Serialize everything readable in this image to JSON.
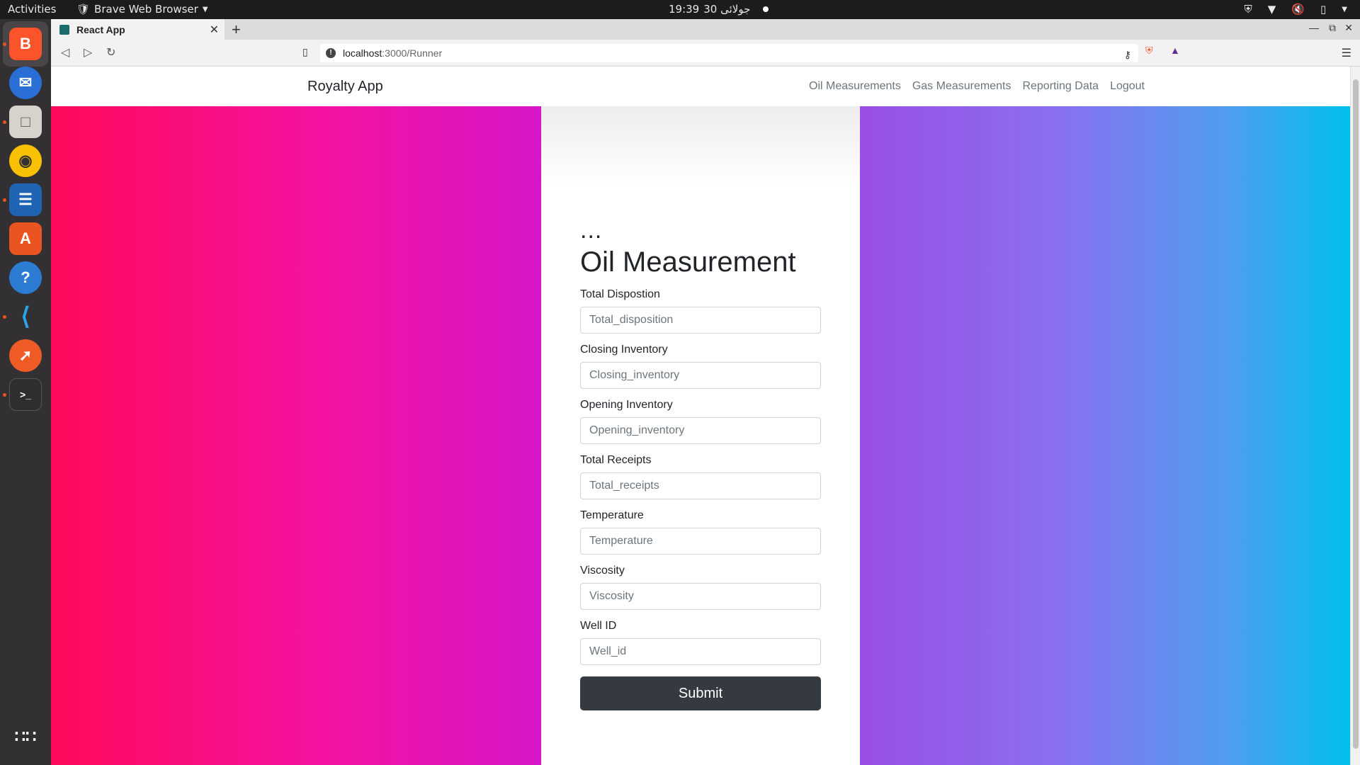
{
  "system": {
    "activities": "Activities",
    "app_menu": "Brave Web Browser",
    "clock_time": "19:39",
    "clock_date": "30 جولائی"
  },
  "dock": {
    "items": [
      "brave-icon",
      "thunderbird-icon",
      "files-icon",
      "rhythmbox-icon",
      "writer-icon",
      "app-center-icon",
      "help-icon",
      "vscode-icon",
      "postman-icon",
      "terminal-icon",
      "show-apps-icon"
    ]
  },
  "browser": {
    "tab_title": "React App",
    "url_host": "localhost",
    "url_path": ":3000/Runner"
  },
  "navbar": {
    "brand": "Royalty App",
    "links": [
      "Oil Measurements",
      "Gas Measurements",
      "Reporting Data",
      "Logout"
    ]
  },
  "form": {
    "ellipsis": "...",
    "title": "Oil Measurement",
    "fields": [
      {
        "label": "Total Dispostion",
        "placeholder": "Total_disposition"
      },
      {
        "label": "Closing Inventory",
        "placeholder": "Closing_inventory"
      },
      {
        "label": "Opening Inventory",
        "placeholder": "Opening_inventory"
      },
      {
        "label": "Total Receipts",
        "placeholder": "Total_receipts"
      },
      {
        "label": "Temperature",
        "placeholder": "Temperature"
      },
      {
        "label": "Viscosity",
        "placeholder": "Viscosity"
      },
      {
        "label": "Well ID",
        "placeholder": "Well_id"
      }
    ],
    "submit_label": "Submit"
  },
  "colors": {
    "left_gradient": [
      "#ff0a5a",
      "#d616c8"
    ],
    "right_gradient": [
      "#9a4fe3",
      "#00bfee"
    ],
    "submit_bg": "#343a40"
  }
}
